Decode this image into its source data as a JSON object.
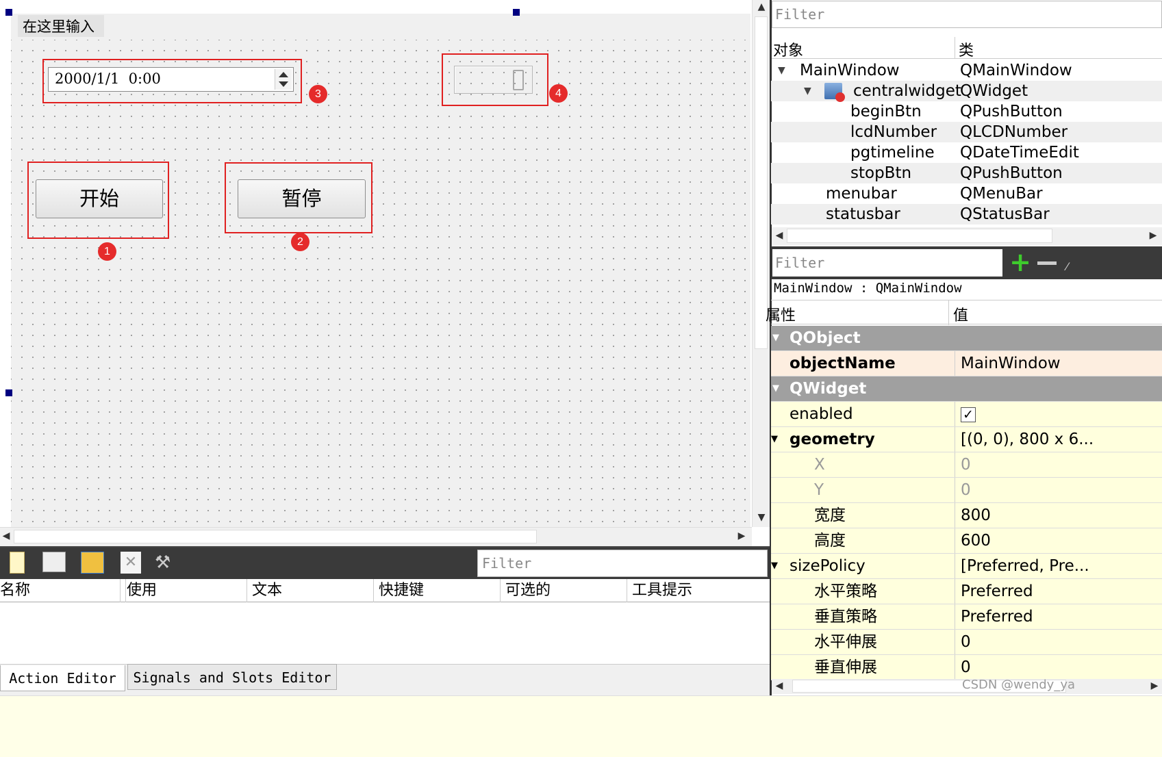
{
  "form": {
    "menu_placeholder": "在这里输入",
    "datetime_value": "2000/1/1  0:00",
    "lcd_digit": "0",
    "begin_label": "开始",
    "pause_label": "暂停",
    "badges": [
      "1",
      "2",
      "3",
      "4"
    ]
  },
  "object_inspector": {
    "filter_placeholder": "Filter",
    "col_object": "对象",
    "col_class": "类",
    "rows": [
      {
        "name": "MainWindow",
        "cls": "QMainWindow"
      },
      {
        "name": "centralwidget",
        "cls": "QWidget"
      },
      {
        "name": "beginBtn",
        "cls": "QPushButton"
      },
      {
        "name": "lcdNumber",
        "cls": "QLCDNumber"
      },
      {
        "name": "pgtimeline",
        "cls": "QDateTimeEdit"
      },
      {
        "name": "stopBtn",
        "cls": "QPushButton"
      },
      {
        "name": "menubar",
        "cls": "QMenuBar"
      },
      {
        "name": "statusbar",
        "cls": "QStatusBar"
      }
    ]
  },
  "property_editor": {
    "filter_placeholder": "Filter",
    "context": "MainWindow : QMainWindow",
    "col_property": "属性",
    "col_value": "值",
    "group_qobject": "QObject",
    "object_name_key": "objectName",
    "object_name_value": "MainWindow",
    "group_qwidget": "QWidget",
    "enabled_key": "enabled",
    "enabled_checked": true,
    "geometry_key": "geometry",
    "geometry_value": "[(0, 0), 800 x 6...",
    "x_key": "X",
    "x_value": "0",
    "y_key": "Y",
    "y_value": "0",
    "width_key": "宽度",
    "width_value": "800",
    "height_key": "高度",
    "height_value": "600",
    "sizepolicy_key": "sizePolicy",
    "sizepolicy_value": "[Preferred, Pre...",
    "hpolicy_key": "水平策略",
    "hpolicy_value": "Preferred",
    "vpolicy_key": "垂直策略",
    "vpolicy_value": "Preferred",
    "hstretch_key": "水平伸展",
    "hstretch_value": "0",
    "vstretch_key": "垂直伸展",
    "vstretch_value": "0",
    "watermark": "CSDN @wendy_ya"
  },
  "action_editor": {
    "filter_placeholder": "Filter",
    "columns": [
      "名称",
      "使用",
      "文本",
      "快捷键",
      "可选的",
      "工具提示"
    ],
    "tabs": [
      "Action Editor",
      "Signals and Slots Editor"
    ]
  },
  "colors": {
    "highlight_red": "#e02020",
    "badge_red": "#e52b2b",
    "property_yellow": "#ffffdd",
    "group_gray": "#a0a0a0",
    "handle_navy": "#000080"
  }
}
